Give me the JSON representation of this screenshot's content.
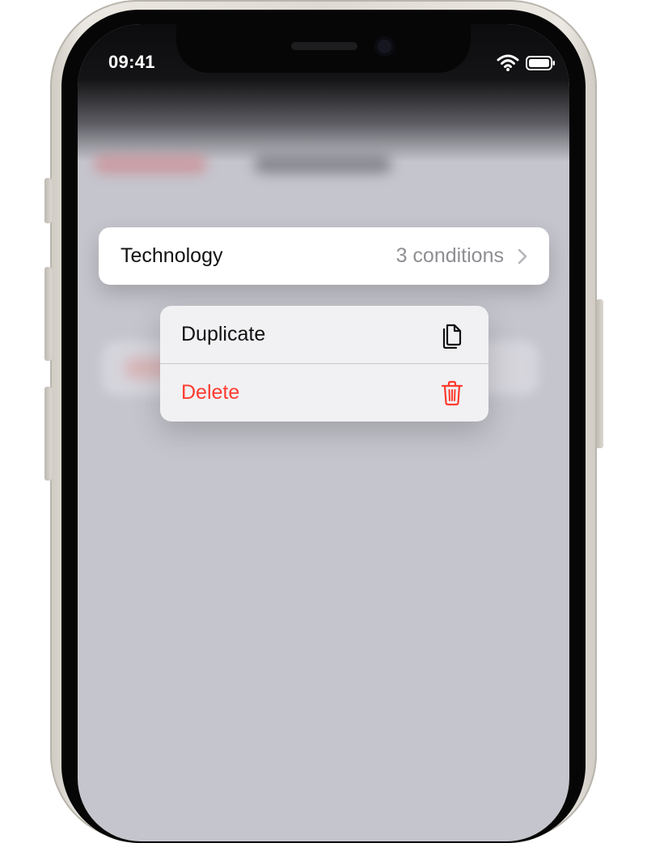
{
  "status_bar": {
    "time": "09:41"
  },
  "focused_row": {
    "title": "Technology",
    "detail": "3 conditions"
  },
  "context_menu": {
    "items": [
      {
        "label": "Duplicate",
        "icon": "duplicate-document-icon"
      },
      {
        "label": "Delete",
        "icon": "trash-icon",
        "destructive": true
      }
    ]
  },
  "colors": {
    "destructive": "#ff3b30",
    "secondary_text": "#8e8e93",
    "screen_dim": "#c5c5cd"
  }
}
